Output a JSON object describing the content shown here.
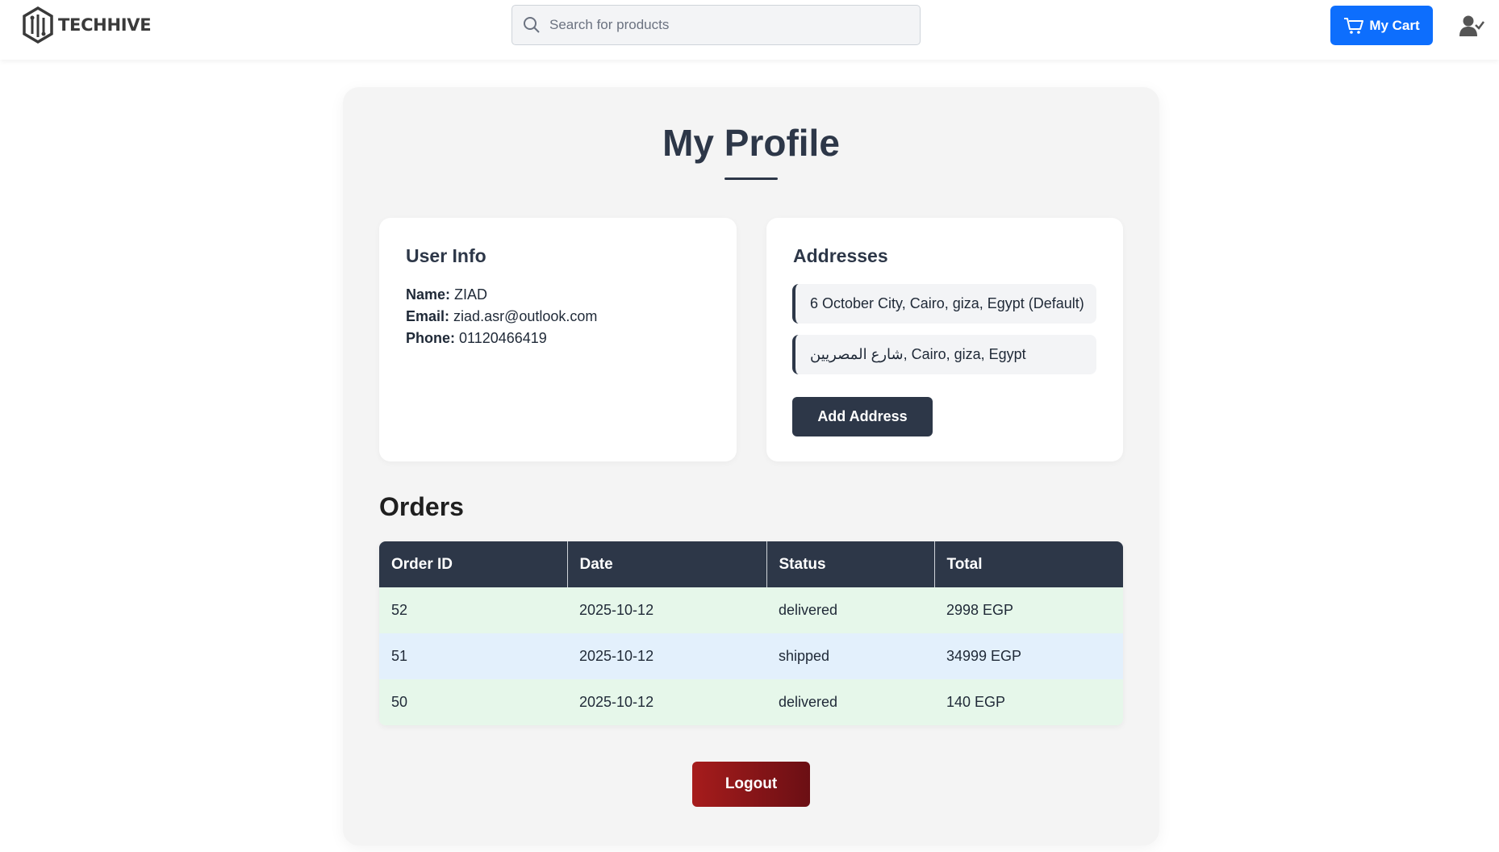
{
  "header": {
    "brand": "TECHHIVE",
    "search_placeholder": "Search for products",
    "cart_label": "My Cart"
  },
  "profile": {
    "title": "My Profile",
    "user_info": {
      "heading": "User Info",
      "name_label": "Name:",
      "name": "ZIAD",
      "email_label": "Email:",
      "email": "ziad.asr@outlook.com",
      "phone_label": "Phone:",
      "phone": "01120466419"
    },
    "addresses": {
      "heading": "Addresses",
      "items": [
        "6 October City, Cairo, giza, Egypt (Default)",
        "شارع المصريين, Cairo, giza, Egypt"
      ],
      "add_button": "Add Address"
    },
    "orders": {
      "heading": "Orders",
      "columns": [
        "Order ID",
        "Date",
        "Status",
        "Total"
      ],
      "rows": [
        {
          "id": "52",
          "date": "2025-10-12",
          "status": "delivered",
          "total": "2998 EGP"
        },
        {
          "id": "51",
          "date": "2025-10-12",
          "status": "shipped",
          "total": "34999 EGP"
        },
        {
          "id": "50",
          "date": "2025-10-12",
          "status": "delivered",
          "total": "140 EGP"
        }
      ]
    },
    "logout_button": "Logout"
  },
  "colors": {
    "primary_dark": "#2d3748",
    "cart_blue": "#0d6efd",
    "delivered_row": "#e6f7ea",
    "shipped_row": "#e3f0fc",
    "logout_red": "#a61c1c"
  },
  "icons": {
    "logo": "hexagon-circuit-logo-icon",
    "search": "search-icon",
    "cart": "cart-icon",
    "user": "user-check-icon"
  }
}
